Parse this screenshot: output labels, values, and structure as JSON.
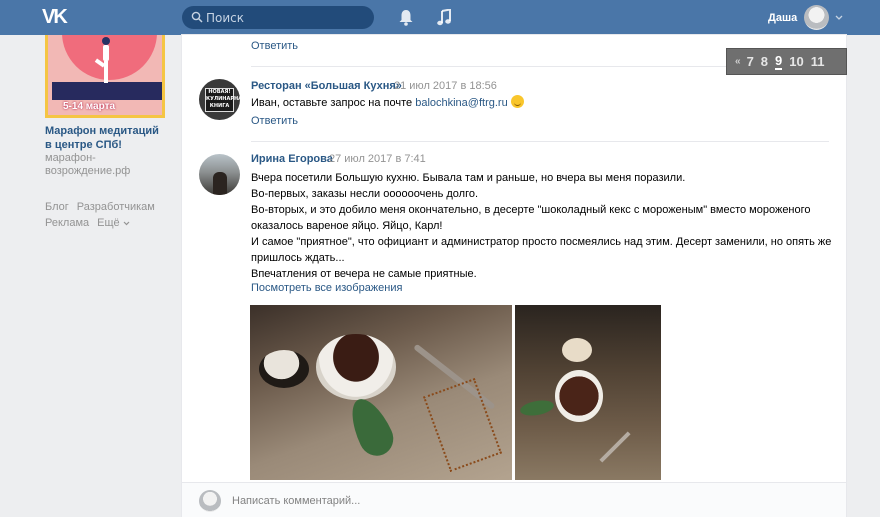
{
  "header": {
    "logo": "VK",
    "search_placeholder": "Поиск",
    "user_name": "Даша"
  },
  "sidebar": {
    "ad": {
      "image_date": "5-14 марта",
      "title": "Марафон медитаций в центре СПб!",
      "domain": "марафон-возрождение.рф"
    },
    "footer_links": [
      "Блог",
      "Разработчикам",
      "Реклама",
      "Ещё"
    ]
  },
  "comments": {
    "top_reply_label": "Ответить",
    "items": [
      {
        "author": "Ресторан «Большая Кухня»",
        "time": "21 июл 2017 в 18:56",
        "text_prefix": "Иван, оставьте запрос на почте ",
        "email": "balochkina@ftrg.ru",
        "emoji": "wink-smile",
        "reply_label": "Ответить",
        "avatar_sign": "НОВАЯ! КУЛИНАРНАЯ КНИГА"
      },
      {
        "author": "Ирина Егорова",
        "time": "27 июл 2017 в 7:41",
        "lines": [
          "Вчера посетили Большую кухню. Бывала там и раньше, но вчера вы меня поразили.",
          "Во-первых, заказы несли оооооочень долго.",
          "Во-вторых, и это добило меня окончательно, в десерте \"шоколадный кекс с мороженым\" вместо мороженого",
          "оказалось вареное яйцо. Яйцо, Карл!",
          "И самое \"приятное\", что официант и администратор просто посмеялись над этим. Десерт заменили, но опять же",
          "пришлось ждать...",
          "Впечатления от вечера не самые приятные."
        ],
        "show_all_images": "Посмотреть все изображения"
      }
    ],
    "comment_placeholder": "Написать комментарий..."
  },
  "pagination": {
    "prev": "«",
    "pages": [
      "7",
      "8",
      "9",
      "10",
      "11"
    ],
    "current": "9"
  }
}
